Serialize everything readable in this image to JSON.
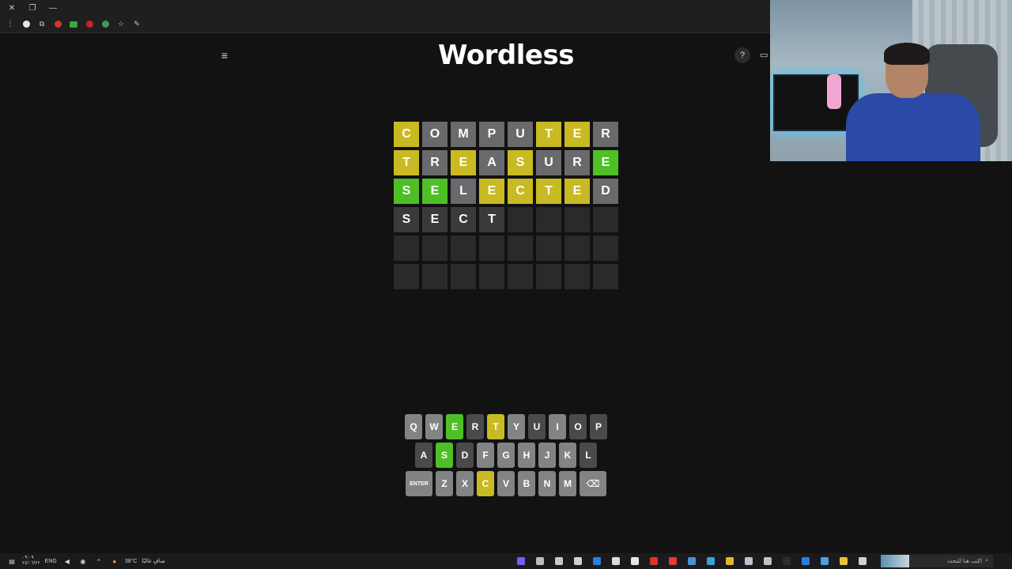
{
  "browser": {
    "window_controls": [
      "✕",
      "❐",
      "—"
    ],
    "toolbar_icons": [
      {
        "name": "menu-dots-icon",
        "glyph": "⋮"
      },
      {
        "name": "profile-icon",
        "color": "#e8e8e8",
        "shape": "dot"
      },
      {
        "name": "extensions-icon",
        "glyph": "⧉"
      },
      {
        "name": "red-extension-icon",
        "color": "#d8342c",
        "shape": "dot"
      },
      {
        "name": "green-extension-icon",
        "color": "#3aa83a",
        "shape": "sq"
      },
      {
        "name": "record-extension-icon",
        "color": "#c8242c",
        "shape": "dot"
      },
      {
        "name": "shield-extension-icon",
        "color": "#3c9a5a",
        "shape": "dot"
      },
      {
        "name": "bookmark-star-icon",
        "glyph": "☆"
      },
      {
        "name": "edit-icon",
        "glyph": "✎"
      }
    ]
  },
  "header": {
    "title": "Wordless",
    "menu_glyph": "≡",
    "help_glyph": "?",
    "calendar_glyph": "▭"
  },
  "board": {
    "rows": [
      {
        "state": "evaluated",
        "tiles": [
          {
            "letter": "C",
            "status": "yellow"
          },
          {
            "letter": "O",
            "status": "gray"
          },
          {
            "letter": "M",
            "status": "gray"
          },
          {
            "letter": "P",
            "status": "gray"
          },
          {
            "letter": "U",
            "status": "gray"
          },
          {
            "letter": "T",
            "status": "yellow"
          },
          {
            "letter": "E",
            "status": "yellow"
          },
          {
            "letter": "R",
            "status": "gray"
          }
        ]
      },
      {
        "state": "evaluated",
        "tiles": [
          {
            "letter": "T",
            "status": "yellow"
          },
          {
            "letter": "R",
            "status": "gray"
          },
          {
            "letter": "E",
            "status": "yellow"
          },
          {
            "letter": "A",
            "status": "gray"
          },
          {
            "letter": "S",
            "status": "yellow"
          },
          {
            "letter": "U",
            "status": "gray"
          },
          {
            "letter": "R",
            "status": "gray"
          },
          {
            "letter": "E",
            "status": "green"
          }
        ]
      },
      {
        "state": "evaluated",
        "tiles": [
          {
            "letter": "S",
            "status": "green"
          },
          {
            "letter": "E",
            "status": "green"
          },
          {
            "letter": "L",
            "status": "gray"
          },
          {
            "letter": "E",
            "status": "yellow"
          },
          {
            "letter": "C",
            "status": "yellow"
          },
          {
            "letter": "T",
            "status": "yellow"
          },
          {
            "letter": "E",
            "status": "yellow"
          },
          {
            "letter": "D",
            "status": "gray"
          }
        ]
      },
      {
        "state": "current",
        "tiles": [
          {
            "letter": "S",
            "status": "tbd"
          },
          {
            "letter": "E",
            "status": "tbd"
          },
          {
            "letter": "C",
            "status": "tbd"
          },
          {
            "letter": "T",
            "status": "tbd"
          },
          {
            "letter": "",
            "status": "empty"
          },
          {
            "letter": "",
            "status": "empty"
          },
          {
            "letter": "",
            "status": "empty"
          },
          {
            "letter": "",
            "status": "empty"
          }
        ]
      },
      {
        "state": "empty",
        "tiles": [
          {
            "letter": "",
            "status": "empty"
          },
          {
            "letter": "",
            "status": "empty"
          },
          {
            "letter": "",
            "status": "empty"
          },
          {
            "letter": "",
            "status": "empty"
          },
          {
            "letter": "",
            "status": "empty"
          },
          {
            "letter": "",
            "status": "empty"
          },
          {
            "letter": "",
            "status": "empty"
          },
          {
            "letter": "",
            "status": "empty"
          }
        ]
      },
      {
        "state": "empty",
        "tiles": [
          {
            "letter": "",
            "status": "empty"
          },
          {
            "letter": "",
            "status": "empty"
          },
          {
            "letter": "",
            "status": "empty"
          },
          {
            "letter": "",
            "status": "empty"
          },
          {
            "letter": "",
            "status": "empty"
          },
          {
            "letter": "",
            "status": "empty"
          },
          {
            "letter": "",
            "status": "empty"
          },
          {
            "letter": "",
            "status": "empty"
          }
        ]
      }
    ]
  },
  "keyboard": {
    "rows": [
      [
        {
          "label": "Q",
          "status": "default"
        },
        {
          "label": "W",
          "status": "default"
        },
        {
          "label": "E",
          "status": "green"
        },
        {
          "label": "R",
          "status": "dark"
        },
        {
          "label": "T",
          "status": "yellow"
        },
        {
          "label": "Y",
          "status": "default"
        },
        {
          "label": "U",
          "status": "dark"
        },
        {
          "label": "I",
          "status": "default"
        },
        {
          "label": "O",
          "status": "dark"
        },
        {
          "label": "P",
          "status": "dark"
        }
      ],
      [
        {
          "label": "A",
          "status": "dark"
        },
        {
          "label": "S",
          "status": "green"
        },
        {
          "label": "D",
          "status": "dark"
        },
        {
          "label": "F",
          "status": "default"
        },
        {
          "label": "G",
          "status": "default"
        },
        {
          "label": "H",
          "status": "default"
        },
        {
          "label": "J",
          "status": "default"
        },
        {
          "label": "K",
          "status": "default"
        },
        {
          "label": "L",
          "status": "dark"
        }
      ],
      [
        {
          "label": "ENTER",
          "status": "default",
          "wide": true
        },
        {
          "label": "Z",
          "status": "default"
        },
        {
          "label": "X",
          "status": "default"
        },
        {
          "label": "C",
          "status": "yellow"
        },
        {
          "label": "V",
          "status": "default"
        },
        {
          "label": "B",
          "status": "default"
        },
        {
          "label": "N",
          "status": "default"
        },
        {
          "label": "M",
          "status": "default"
        },
        {
          "label": "⌫",
          "status": "default",
          "wide": true
        }
      ]
    ]
  },
  "taskbar": {
    "clock_time": "٠٩:٠٩",
    "clock_date": "٢٤/٠٦/٢٢",
    "language": "ENG",
    "weather": "38°C",
    "weather_text": "صافٍ غالبًا",
    "search_placeholder": "اكتب هنا للبحث",
    "apps": [
      {
        "name": "app-purple-icon",
        "color": "#7d5af0"
      },
      {
        "name": "app-steam-small-icon",
        "color": "#bcbcbc"
      },
      {
        "name": "app-folder-blue-icon",
        "color": "#c9c9c9"
      },
      {
        "name": "app-obs-icon",
        "color": "#d0d0d0"
      },
      {
        "name": "app-blue-icon",
        "color": "#2a7fe0"
      },
      {
        "name": "app-grid-icon",
        "color": "#dcdcdc"
      },
      {
        "name": "app-capcut-icon",
        "color": "#e6e6e6"
      },
      {
        "name": "app-record-icon",
        "color": "#d8342c"
      },
      {
        "name": "app-red-a-icon",
        "color": "#e03a3a"
      },
      {
        "name": "app-screen-icon",
        "color": "#4a90d9"
      },
      {
        "name": "app-arrow-icon",
        "color": "#3aa0e0"
      },
      {
        "name": "app-chrome-icon",
        "color": "#e8b22c"
      },
      {
        "name": "app-steam-icon",
        "color": "#b8c4cc"
      },
      {
        "name": "app-gear-icon",
        "color": "#c0c0c0"
      },
      {
        "name": "app-terminal-icon",
        "color": "#2c2c2c"
      },
      {
        "name": "app-edge-icon",
        "color": "#2a7fe0"
      },
      {
        "name": "app-store-icon",
        "color": "#4aa0e8"
      },
      {
        "name": "app-explorer-icon",
        "color": "#e8c23c"
      },
      {
        "name": "app-taskview-icon",
        "color": "#d0d0d0"
      }
    ]
  },
  "colors": {
    "background": "#121213",
    "yellow": "#c9b923",
    "green": "#4fbf26",
    "gray": "#6a6a6c",
    "key_default": "#818384"
  }
}
